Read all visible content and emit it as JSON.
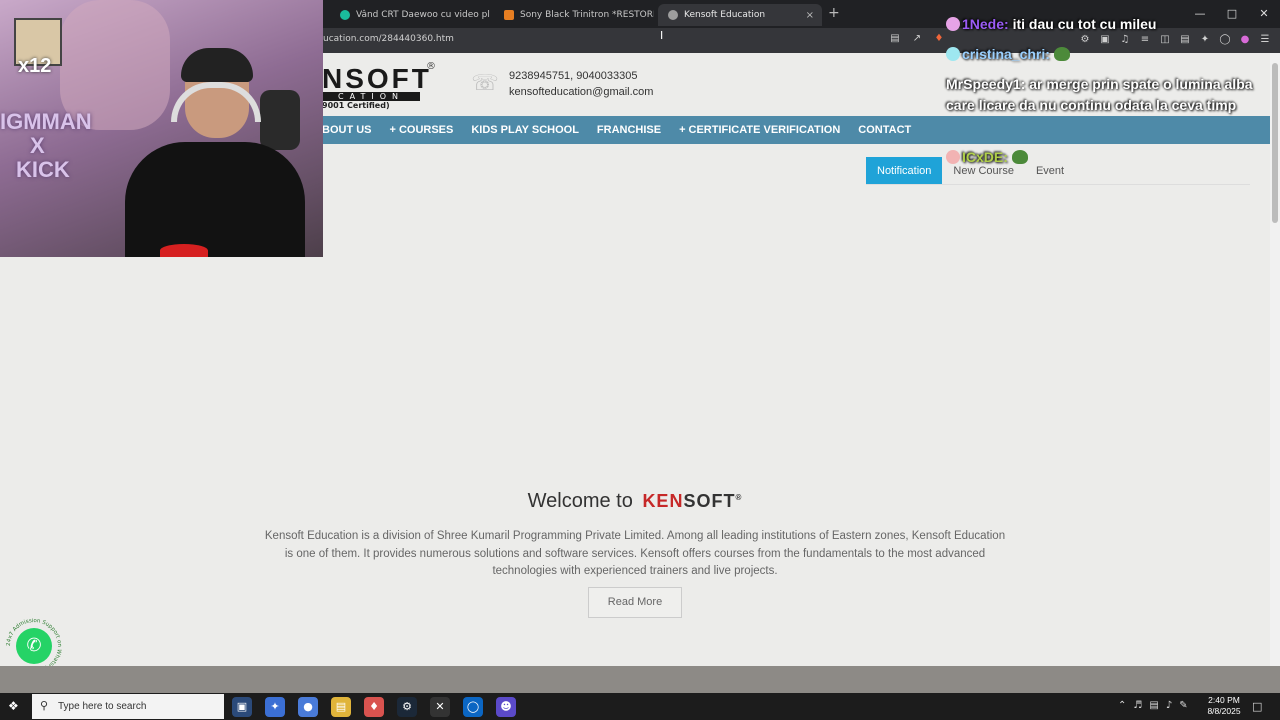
{
  "browser": {
    "tabs": [
      {
        "label": "Vând CRT Daewoo cu video player in",
        "color": "#1abc9c"
      },
      {
        "label": "Sony Black Trinitron *RESTORED* - KV",
        "color": "#e67e22"
      },
      {
        "label": "Kensoft Education",
        "color": "#9e9e9e"
      }
    ],
    "new_tab_symbol": "+",
    "close_symbol": "×",
    "url": "ucation.com/284440360.htm"
  },
  "site": {
    "logo": {
      "main": "NSOFT",
      "reg": "®",
      "sub": "CATION",
      "cert": "9001 Certified)"
    },
    "phones": "9238945751, 9040033305",
    "email": "kensofteducation@gmail.com",
    "nav": [
      {
        "label": "BOUT US",
        "plus": false
      },
      {
        "label": "COURSES",
        "plus": true
      },
      {
        "label": "KIDS PLAY SCHOOL",
        "plus": false
      },
      {
        "label": "FRANCHISE",
        "plus": false
      },
      {
        "label": "CERTIFICATE VERIFICATION",
        "plus": true
      },
      {
        "label": "CONTACT",
        "plus": false
      }
    ],
    "plus_symbol": "+",
    "info_tabs": [
      {
        "label": "Notification",
        "active": true
      },
      {
        "label": "New Course",
        "active": false
      },
      {
        "label": "Event",
        "active": false
      }
    ],
    "welcome_prefix": "Welcome to",
    "welcome_logo_k": "KEN",
    "welcome_logo_rest": "SOFT",
    "welcome_logo_reg": "®",
    "description": "Kensoft Education is a division of Shree Kumaril Programming Private Limited. Among all leading institutions of Eastern zones, Kensoft Education is one of them. It provides numerous solutions and software services. Kensoft offers courses from the fundamentals to the most advanced technologies with experienced trainers and live projects.",
    "read_more": "Read More",
    "whatsapp_ring_text": "24x7 Admission Support on WhatsApp"
  },
  "stream": {
    "x_count": "x12",
    "brand_lines": [
      "IGMMAN",
      "X",
      "KICK"
    ]
  },
  "chat": {
    "messages": [
      {
        "user": "1Nede:",
        "text": "iti dau cu tot cu mileu"
      },
      {
        "user": "cristina_chri:",
        "text": ""
      },
      {
        "user": "MrSpeedy1:",
        "text": "ar merge prin spate o lumina alba care licare da nu continu odata la ceva timp"
      },
      {
        "user": "ICxDE:",
        "text": ""
      }
    ]
  },
  "taskbar": {
    "search_placeholder": "Type here to search",
    "time": "2:40 PM",
    "date": "8/8/2025"
  }
}
